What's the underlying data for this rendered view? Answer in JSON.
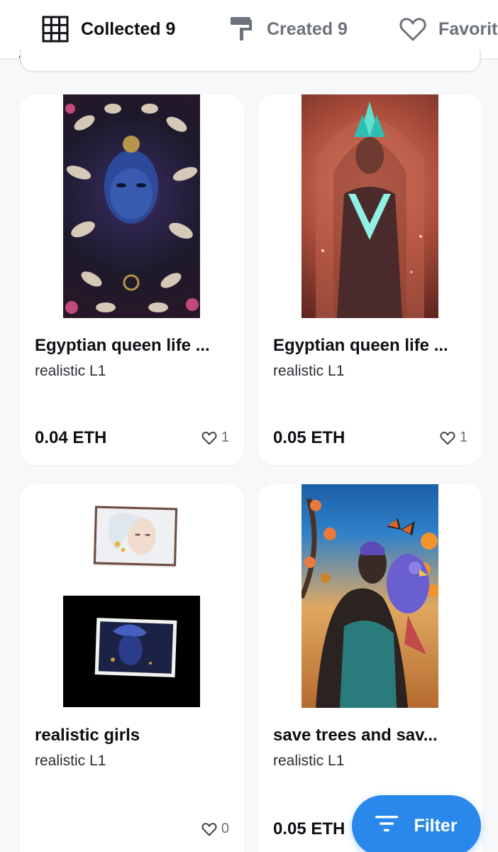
{
  "tabs": [
    {
      "label": "Collected 9",
      "icon": "grid-icon",
      "active": true
    },
    {
      "label": "Created 9",
      "icon": "paint-roller-icon",
      "active": false
    },
    {
      "label": "Favorites",
      "icon": "heart-icon",
      "active": false
    }
  ],
  "cards": [
    {
      "title": "Egyptian queen life ...",
      "creator": "realistic L1",
      "price": "0.04 ETH",
      "likes": "1",
      "art": "ornate-blue-face-with-leaves"
    },
    {
      "title": "Egyptian queen life ...",
      "creator": "realistic L1",
      "price": "0.05 ETH",
      "likes": "1",
      "art": "glowing-queen-in-archway"
    },
    {
      "title": "realistic girls",
      "creator": "realistic L1",
      "price": "",
      "likes": "0",
      "art": "two-framed-portraits"
    },
    {
      "title": "save trees and sav...",
      "creator": "realistic L1",
      "price": "0.05 ETH",
      "likes": "",
      "art": "woman-with-birds-and-butterfly"
    }
  ],
  "fab": {
    "label": "Filter",
    "icon": "filter-icon"
  },
  "colors": {
    "accent": "#2a88ea",
    "text": "#0d0f14",
    "muted": "#6d727a",
    "background": "#f7f8fa"
  }
}
